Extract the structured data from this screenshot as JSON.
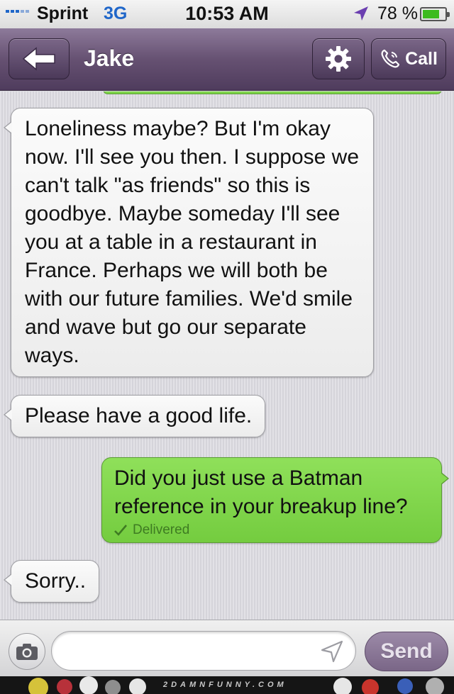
{
  "status_bar": {
    "carrier": "Sprint",
    "network": "3G",
    "time": "10:53 AM",
    "battery_percent": "78 %",
    "icons": [
      "signal-icon",
      "location-icon",
      "battery-icon"
    ]
  },
  "nav": {
    "title": "Jake",
    "back_icon": "back-arrow-icon",
    "settings_icon": "gear-icon",
    "call_label": "Call",
    "call_icon": "phone-icon"
  },
  "messages": [
    {
      "direction": "incoming",
      "text": "Loneliness maybe? But I'm okay now. I'll see you then. I suppose we can't talk \"as friends\" so this is goodbye. Maybe someday I'll see you at a table in a restaurant in France. Perhaps we will both be with our future families. We'd smile and wave but go our separate ways."
    },
    {
      "direction": "incoming",
      "text": "Please have a good life."
    },
    {
      "direction": "outgoing",
      "text": "Did you just use a Batman reference in your breakup line?",
      "status": "Delivered"
    },
    {
      "direction": "incoming",
      "text": "Sorry.."
    }
  ],
  "composer": {
    "camera_icon": "camera-icon",
    "placeholder": "",
    "send_label": "Send",
    "send_icon": "location-arrow-icon"
  },
  "watermark": {
    "text": "2DAMNFUNNY.COM"
  },
  "colors": {
    "nav_purple": "#665172",
    "incoming_bubble": "#f5f5f5",
    "outgoing_bubble": "#80d44d",
    "delivered_text": "#3e7b22",
    "status_blue": "#1f66c9",
    "battery_green": "#3dbb1e"
  }
}
